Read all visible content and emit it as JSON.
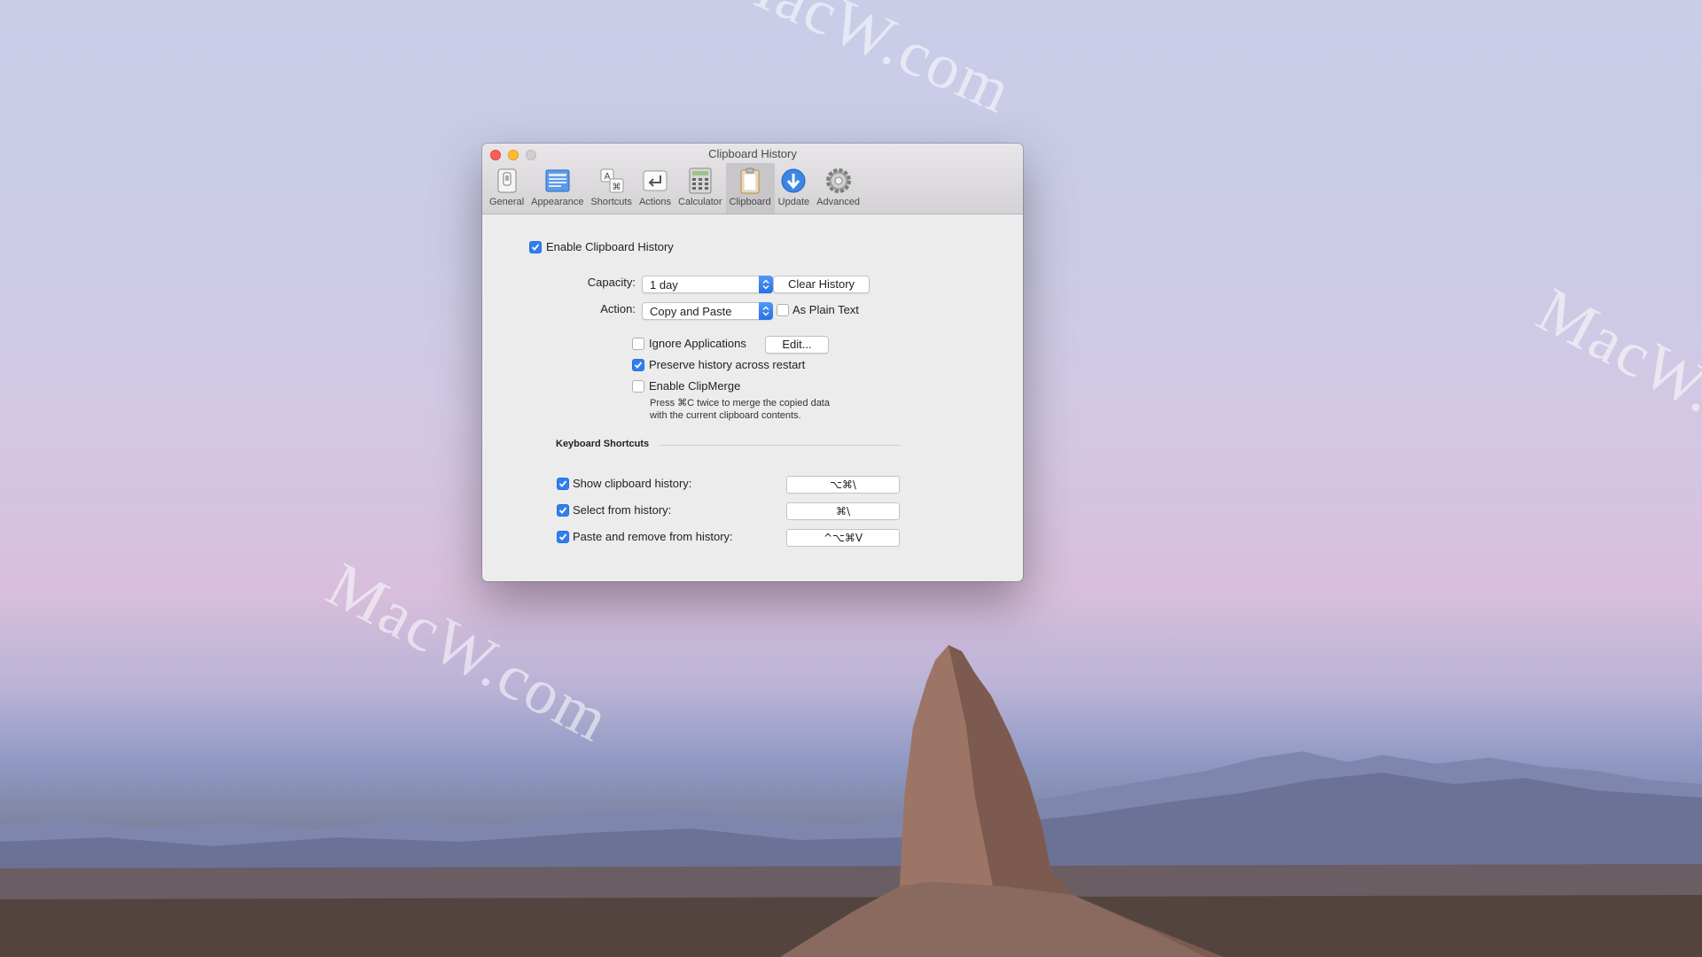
{
  "desktop": {
    "watermarks": [
      "MacW.com",
      "MacW.com",
      "MacW.com"
    ]
  },
  "window": {
    "title": "Clipboard History",
    "toolbar": [
      {
        "label": "General",
        "icon": "general-icon",
        "selected": false
      },
      {
        "label": "Appearance",
        "icon": "appearance-icon",
        "selected": false
      },
      {
        "label": "Shortcuts",
        "icon": "shortcuts-icon",
        "selected": false
      },
      {
        "label": "Actions",
        "icon": "actions-icon",
        "selected": false
      },
      {
        "label": "Calculator",
        "icon": "calculator-icon",
        "selected": false
      },
      {
        "label": "Clipboard",
        "icon": "clipboard-icon",
        "selected": true
      },
      {
        "label": "Update",
        "icon": "update-icon",
        "selected": false
      },
      {
        "label": "Advanced",
        "icon": "gear-icon",
        "selected": false
      }
    ]
  },
  "clipboard": {
    "enable_history": {
      "label": "Enable Clipboard History",
      "checked": true
    },
    "capacity": {
      "label": "Capacity:",
      "value": "1 day"
    },
    "clear_history_label": "Clear History",
    "action": {
      "label": "Action:",
      "value": "Copy and Paste"
    },
    "plain_text": {
      "label": "As Plain Text",
      "checked": false
    },
    "ignore_apps": {
      "label": "Ignore Applications",
      "checked": false
    },
    "edit_label": "Edit...",
    "preserve": {
      "label": "Preserve history across restart",
      "checked": true
    },
    "clipmerge": {
      "label": "Enable ClipMerge",
      "checked": false
    },
    "clipmerge_note_line1": "Press ⌘C twice to merge the copied data",
    "clipmerge_note_line2": "with the current clipboard contents."
  },
  "shortcuts": {
    "section_title": "Keyboard Shortcuts",
    "items": [
      {
        "label": "Show clipboard history:",
        "checked": true,
        "keys": "⌥⌘\\"
      },
      {
        "label": "Select from history:",
        "checked": true,
        "keys": "⌘\\"
      },
      {
        "label": "Paste and remove from history:",
        "checked": true,
        "keys": "^⌥⌘V"
      }
    ]
  },
  "colors": {
    "accent": "#2f7ff0",
    "close": "#fe5f57",
    "minimize": "#febc2e",
    "zoom": "#d1cfd1"
  }
}
